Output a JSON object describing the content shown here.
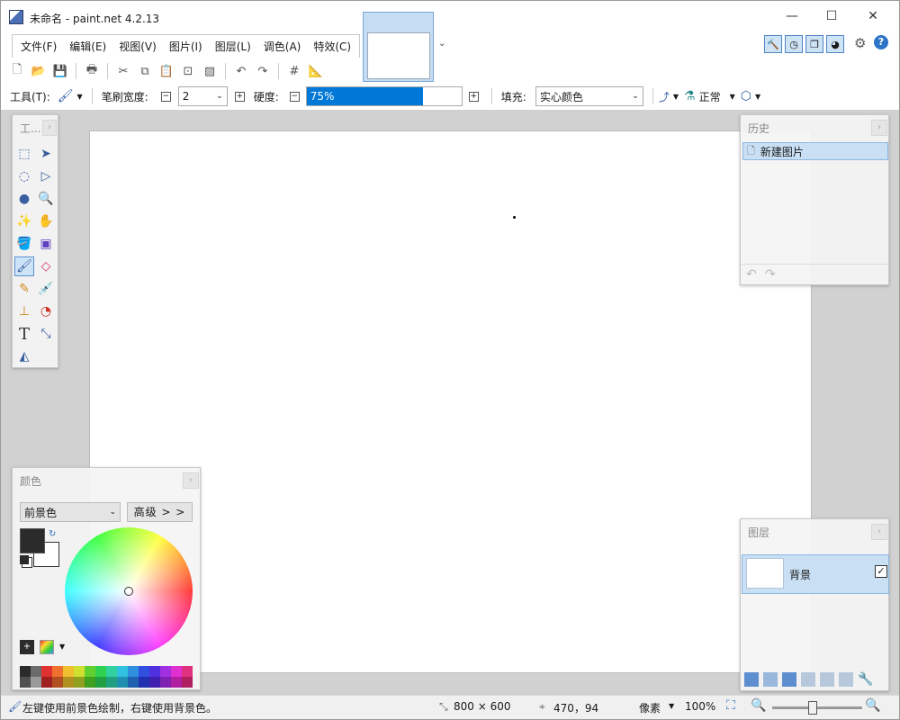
{
  "window": {
    "title": "未命名 - paint.net 4.2.13",
    "minimize": "—",
    "maximize": "☐",
    "close": "✕"
  },
  "menu": [
    "文件(F)",
    "编辑(E)",
    "视图(V)",
    "图片(I)",
    "图层(L)",
    "调色(A)",
    "特效(C)"
  ],
  "tool_options": {
    "tool_label": "工具(T):",
    "brush_width_label": "笔刷宽度:",
    "brush_width_value": "2",
    "hardness_label": "硬度:",
    "hardness_value": "75%",
    "hardness_fraction": 0.75,
    "fill_label": "填充:",
    "fill_value": "实心颜色",
    "blend_mode": "正常"
  },
  "tools_panel": {
    "title": "工..."
  },
  "history_panel": {
    "title": "历史",
    "items": [
      "新建图片"
    ]
  },
  "colors_panel": {
    "title": "颜色",
    "mode_value": "前景色",
    "advanced_button": "高级 > >",
    "palette": [
      "#2b2b2b",
      "#6b6b6b",
      "#e03030",
      "#f07030",
      "#f0c030",
      "#d0e030",
      "#60d030",
      "#30d050",
      "#30d0a0",
      "#30c0e0",
      "#3090e0",
      "#3050e0",
      "#5030e0",
      "#a030e0",
      "#e030d0",
      "#e03080",
      "#505050",
      "#9a9a9a",
      "#a02020",
      "#b05020",
      "#b09020",
      "#90a020",
      "#40a020",
      "#20a040",
      "#20a080",
      "#2090b0",
      "#2060b0",
      "#2030b0",
      "#4020b0",
      "#8020b0",
      "#b020a0",
      "#b02060"
    ]
  },
  "layers_panel": {
    "title": "图层",
    "layers": [
      {
        "name": "背景",
        "visible": true
      }
    ]
  },
  "status": {
    "hint": "左键使用前景色绘制，右键使用背景色。",
    "image_size": "800 × 600",
    "cursor_pos": "470，94",
    "unit": "像素",
    "zoom": "100%"
  },
  "colors": {
    "accent": "#0078d7",
    "selection": "#c9dff3"
  }
}
